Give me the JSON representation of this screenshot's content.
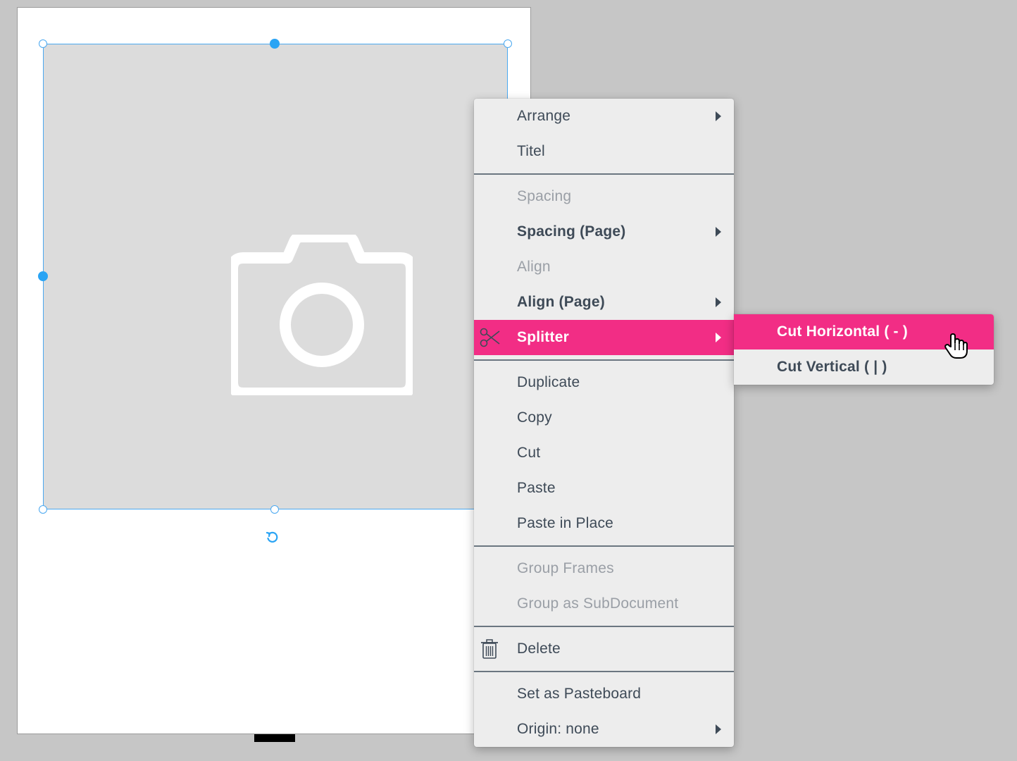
{
  "context_menu": {
    "items": [
      {
        "label": "Arrange",
        "submenu": true
      },
      {
        "label": "Titel"
      },
      {
        "label": "Spacing",
        "disabled": true
      },
      {
        "label": "Spacing (Page)",
        "bold": true,
        "submenu": true
      },
      {
        "label": "Align",
        "disabled": true
      },
      {
        "label": "Align (Page)",
        "bold": true,
        "submenu": true
      },
      {
        "label": "Splitter",
        "active": true,
        "submenu": true,
        "icon": "scissors-icon"
      },
      {
        "label": "Duplicate"
      },
      {
        "label": "Copy"
      },
      {
        "label": "Cut"
      },
      {
        "label": "Paste"
      },
      {
        "label": "Paste in Place"
      },
      {
        "label": "Group Frames",
        "disabled": true
      },
      {
        "label": "Group as SubDocument",
        "disabled": true
      },
      {
        "label": "Delete",
        "icon": "trash-icon"
      },
      {
        "label": "Set as Pasteboard"
      },
      {
        "label": "Origin: none",
        "submenu": true
      }
    ]
  },
  "splitter_submenu": {
    "items": [
      {
        "label": "Cut Horizontal ( - )",
        "active": true
      },
      {
        "label": "Cut Vertical ( | )"
      }
    ]
  },
  "canvas": {
    "frame_icon": "camera-icon",
    "rotate_icon": "rotate-icon"
  },
  "colors": {
    "accent": "#f22d85",
    "selection": "#2aa4f4",
    "menu_bg": "#ededed",
    "menu_text": "#3e4a57"
  }
}
